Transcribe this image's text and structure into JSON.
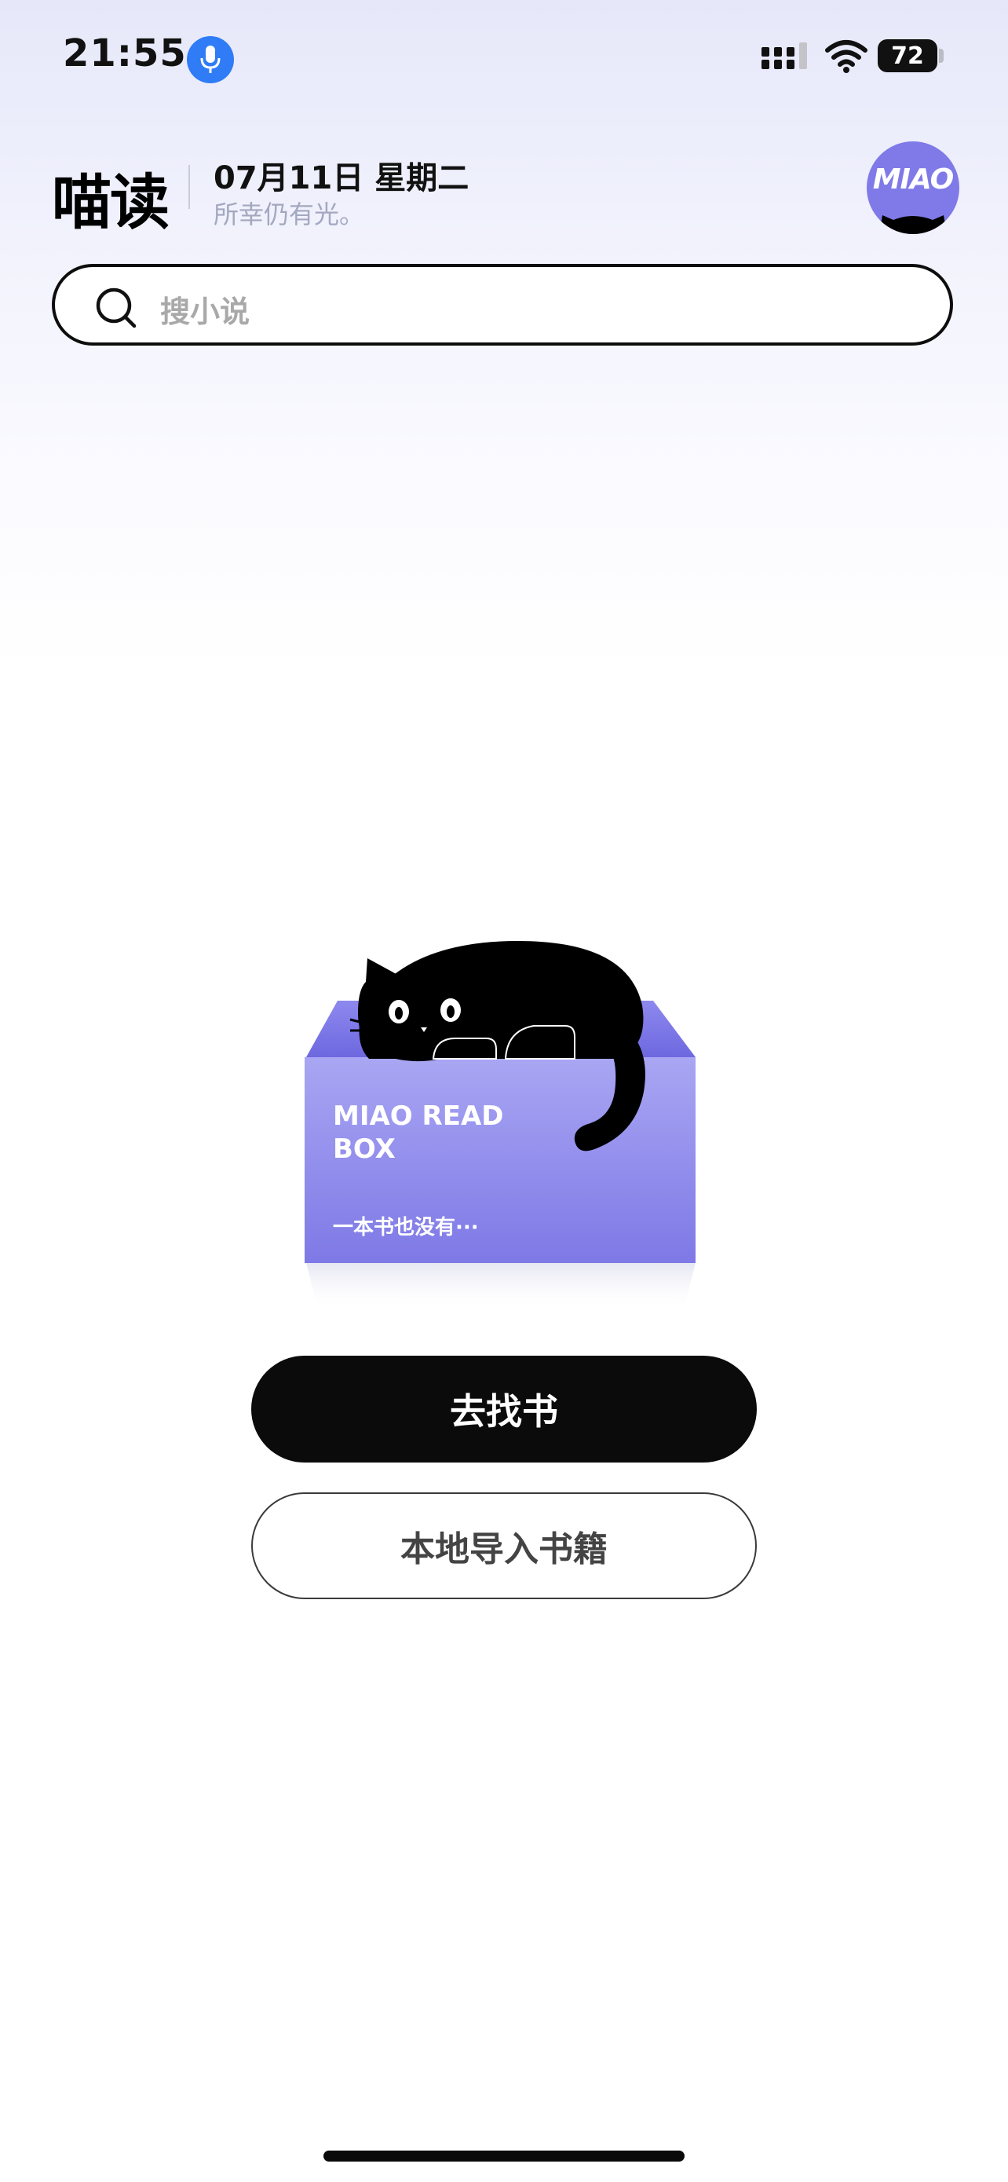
{
  "status_bar": {
    "time": "21:55",
    "battery": "72",
    "icons": [
      "microphone-icon",
      "signal-icon",
      "wifi-icon",
      "battery-icon"
    ]
  },
  "header": {
    "app_name": "喵读",
    "date": "07月11日 星期二",
    "slogan": "所幸仍有光。",
    "avatar_text": "MIAO"
  },
  "search": {
    "placeholder": "搜小说"
  },
  "empty_state": {
    "box_title_line1": "MIAO READ",
    "box_title_line2": "BOX",
    "box_caption": "一本书也没有···"
  },
  "actions": {
    "find_books": "去找书",
    "import_local": "本地导入书籍"
  },
  "colors": {
    "accent_purple": "#7f7ae8",
    "mic_blue": "#2f7cf6",
    "primary_button": "#0b0b0b"
  }
}
